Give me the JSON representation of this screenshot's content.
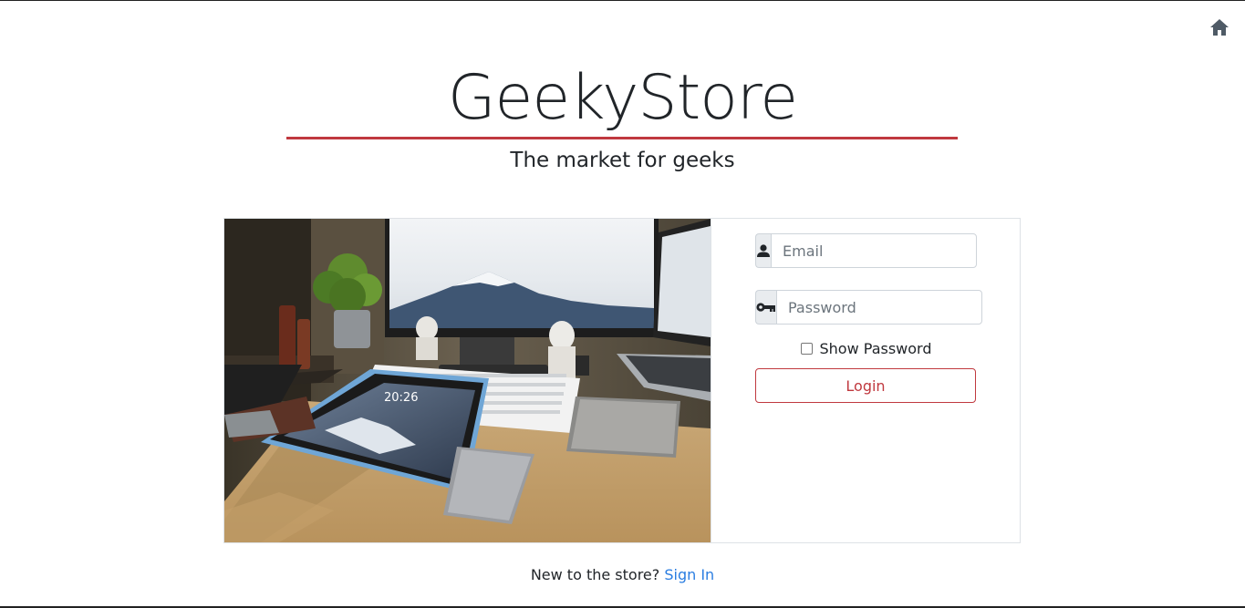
{
  "header": {
    "title": "GeekyStore",
    "subtitle": "The market for geeks",
    "home_icon": "home-icon"
  },
  "login_form": {
    "email_placeholder": "Email",
    "email_icon": "user-icon",
    "password_placeholder": "Password",
    "password_icon": "key-icon",
    "show_password_label": "Show Password",
    "show_password_checked": false,
    "login_button": "Login"
  },
  "footer": {
    "prompt": "New to the store?",
    "signin_link": "Sign In"
  },
  "colors": {
    "accent": "#c0393f",
    "link": "#2a7de1",
    "addon_bg": "#e9ecef"
  }
}
